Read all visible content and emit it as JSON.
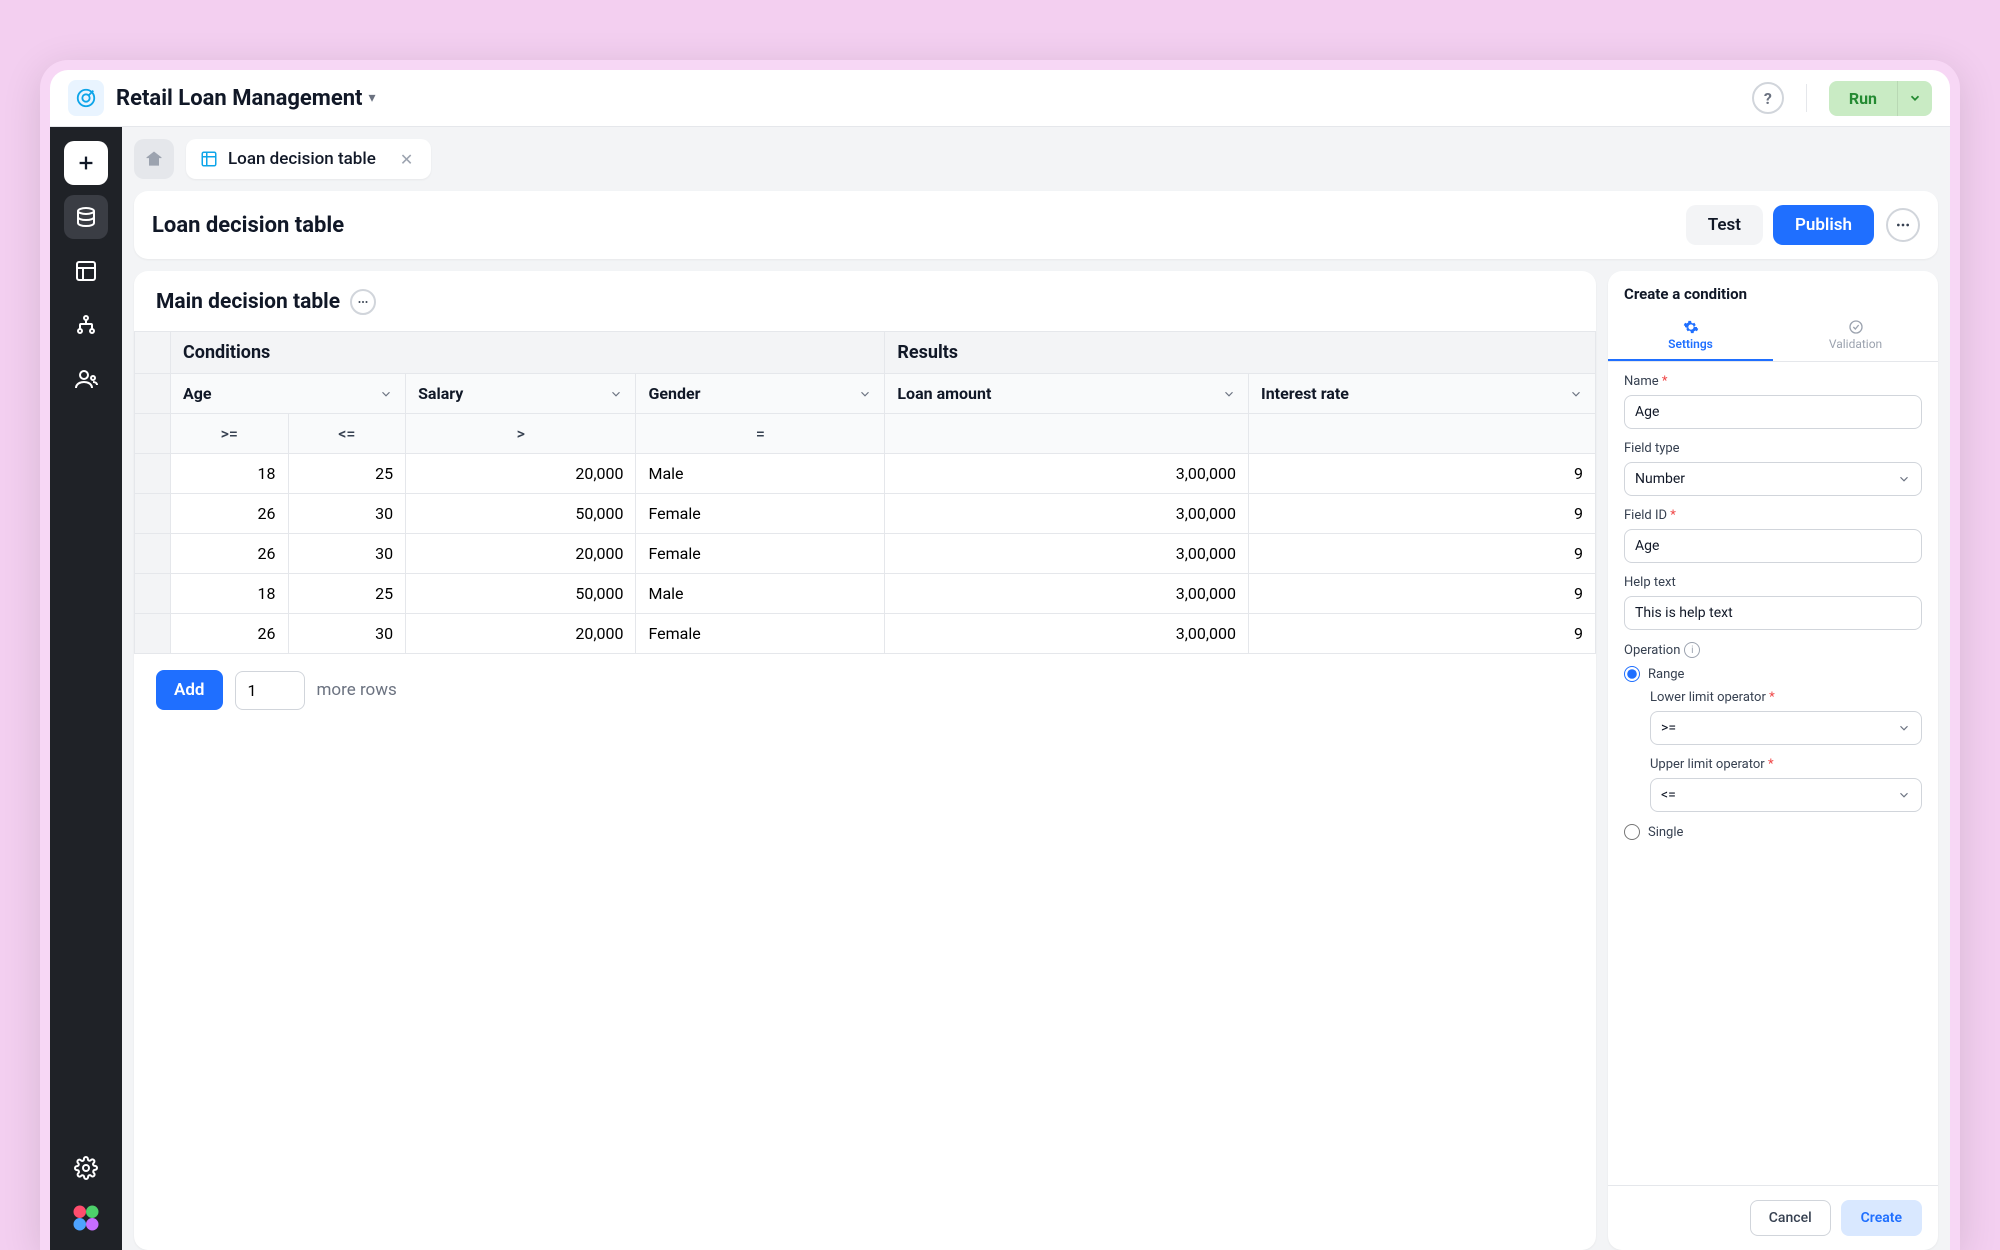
{
  "app_title": "Retail Loan Management",
  "run_label": "Run",
  "tab": {
    "label": "Loan decision table"
  },
  "page": {
    "title": "Loan decision table",
    "test_label": "Test",
    "publish_label": "Publish"
  },
  "table": {
    "title": "Main decision table",
    "group_headers": {
      "conditions": "Conditions",
      "results": "Results"
    },
    "columns": {
      "age": "Age",
      "salary": "Salary",
      "gender": "Gender",
      "loan_amount": "Loan amount",
      "interest_rate": "Interest rate"
    },
    "operators": {
      "age_lo": ">=",
      "age_hi": "<=",
      "salary": ">",
      "gender": "="
    },
    "rows": [
      {
        "age_lo": "18",
        "age_hi": "25",
        "salary": "20,000",
        "gender": "Male",
        "loan_amount": "3,00,000",
        "interest_rate": "9"
      },
      {
        "age_lo": "26",
        "age_hi": "30",
        "salary": "50,000",
        "gender": "Female",
        "loan_amount": "3,00,000",
        "interest_rate": "9"
      },
      {
        "age_lo": "26",
        "age_hi": "30",
        "salary": "20,000",
        "gender": "Female",
        "loan_amount": "3,00,000",
        "interest_rate": "9"
      },
      {
        "age_lo": "18",
        "age_hi": "25",
        "salary": "50,000",
        "gender": "Male",
        "loan_amount": "3,00,000",
        "interest_rate": "9"
      },
      {
        "age_lo": "26",
        "age_hi": "30",
        "salary": "20,000",
        "gender": "Female",
        "loan_amount": "3,00,000",
        "interest_rate": "9"
      }
    ],
    "footer": {
      "add_label": "Add",
      "row_count_value": "1",
      "more_rows_text": "more rows"
    }
  },
  "panel": {
    "title": "Create a condition",
    "tabs": {
      "settings": "Settings",
      "validation": "Validation"
    },
    "labels": {
      "name": "Name",
      "field_type": "Field type",
      "field_id": "Field ID",
      "help_text": "Help text",
      "operation": "Operation",
      "range": "Range",
      "lower_limit": "Lower limit operator",
      "upper_limit": "Upper limit operator",
      "single": "Single"
    },
    "values": {
      "name": "Age",
      "field_type": "Number",
      "field_id": "Age",
      "help_text": "This is help text",
      "lower_limit": ">=",
      "upper_limit": "<="
    },
    "footer": {
      "cancel": "Cancel",
      "create": "Create"
    }
  }
}
